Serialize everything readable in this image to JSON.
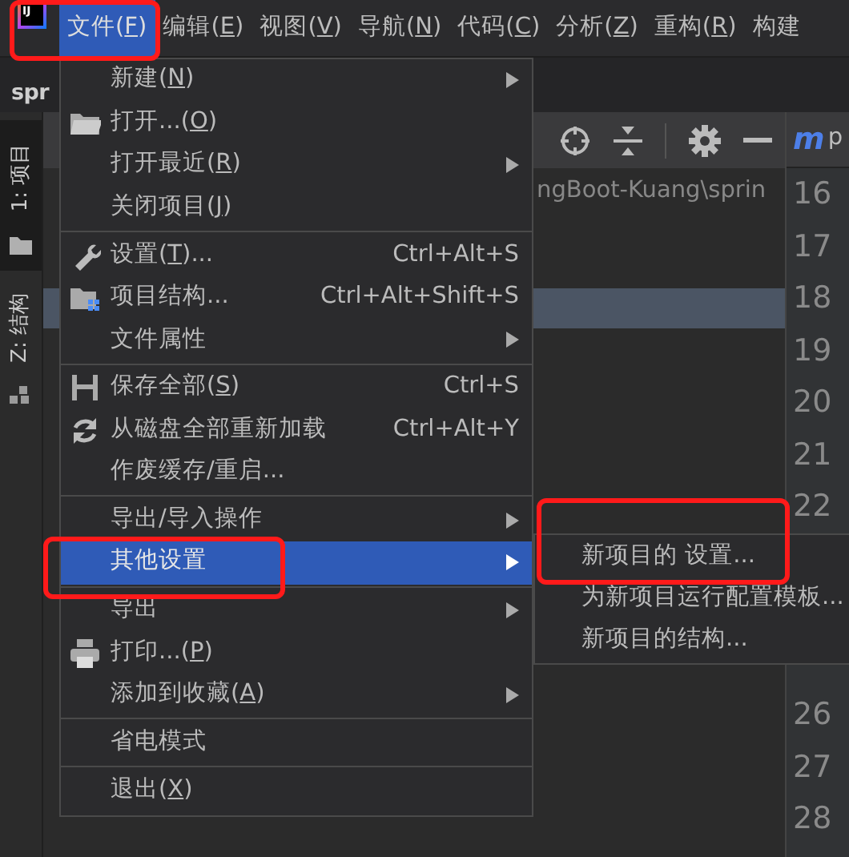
{
  "logo": {
    "text": "IJ"
  },
  "menu_bar": [
    {
      "label_parts": [
        "文件(",
        "F",
        ")"
      ],
      "selected": true,
      "annotated": true
    },
    {
      "label_parts": [
        "编辑(",
        "E",
        ")"
      ],
      "selected": false,
      "annotated": false
    },
    {
      "label_parts": [
        "视图(",
        "V",
        ")"
      ],
      "selected": false,
      "annotated": false
    },
    {
      "label_parts": [
        "导航(",
        "N",
        ")"
      ],
      "selected": false,
      "annotated": false
    },
    {
      "label_parts": [
        "代码(",
        "C",
        ")"
      ],
      "selected": false,
      "annotated": false
    },
    {
      "label_parts": [
        "分析(",
        "Z",
        ")"
      ],
      "selected": false,
      "annotated": false
    },
    {
      "label_parts": [
        "重构(",
        "R",
        ")"
      ],
      "selected": false,
      "annotated": false
    },
    {
      "label": "构建",
      "selected": false,
      "annotated": false
    }
  ],
  "navigation_bar": {
    "project": "spr"
  },
  "tool_strip": [
    {
      "label": "1: 项目",
      "selected": true
    },
    {
      "label": "Z: 结构",
      "selected": false
    }
  ],
  "project_panel": {
    "path": "ngBoot-Kuang\\sprin"
  },
  "editor": {
    "tab": {
      "icon_letter": "m",
      "label": "p"
    },
    "line_numbers": [
      "16",
      "17",
      "18",
      "19",
      "20",
      "21",
      "22"
    ],
    "line_numbers_below_menu": [
      "26",
      "27",
      "28"
    ]
  },
  "file_menu": {
    "items": [
      {
        "kind": "item",
        "label_parts": [
          "新建(",
          "N",
          ")"
        ],
        "has_submenu": true,
        "selected": false,
        "annotated": false
      },
      {
        "kind": "item",
        "label_parts": [
          "打开...(",
          "O",
          ")"
        ],
        "has_submenu": false,
        "selected": false,
        "annotated": false
      },
      {
        "kind": "item",
        "label_parts": [
          "打开最近(",
          "R",
          ")"
        ],
        "has_submenu": true,
        "selected": false,
        "annotated": false
      },
      {
        "kind": "item",
        "label_parts": [
          "关闭项目(",
          "J",
          ")"
        ],
        "has_submenu": false,
        "selected": false,
        "annotated": false
      },
      {
        "kind": "separator"
      },
      {
        "kind": "item",
        "label_parts": [
          "设置(",
          "T",
          ")..."
        ],
        "shortcut": "Ctrl+Alt+S",
        "has_submenu": false,
        "selected": false,
        "annotated": false
      },
      {
        "kind": "item",
        "label": "项目结构...",
        "shortcut": "Ctrl+Alt+Shift+S",
        "has_submenu": false,
        "selected": false,
        "annotated": false
      },
      {
        "kind": "item",
        "label": "文件属性",
        "has_submenu": true,
        "selected": false,
        "annotated": false
      },
      {
        "kind": "separator"
      },
      {
        "kind": "item",
        "label_parts": [
          "保存全部(",
          "S",
          ")"
        ],
        "shortcut": "Ctrl+S",
        "has_submenu": false,
        "selected": false,
        "annotated": false
      },
      {
        "kind": "item",
        "label": "从磁盘全部重新加载",
        "shortcut": "Ctrl+Alt+Y",
        "has_submenu": false,
        "selected": false,
        "annotated": false
      },
      {
        "kind": "item",
        "label": "作废缓存/重启...",
        "has_submenu": false,
        "selected": false,
        "annotated": false
      },
      {
        "kind": "separator"
      },
      {
        "kind": "item",
        "label": "导出/导入操作",
        "has_submenu": true,
        "selected": false,
        "annotated": false
      },
      {
        "kind": "item",
        "label": "其他设置",
        "has_submenu": true,
        "selected": true,
        "annotated": true
      },
      {
        "kind": "separator"
      },
      {
        "kind": "item",
        "label": "导出",
        "has_submenu": true,
        "selected": false,
        "annotated": false
      },
      {
        "kind": "item",
        "label_parts": [
          "打印...(",
          "P",
          ")"
        ],
        "has_submenu": false,
        "selected": false,
        "annotated": false
      },
      {
        "kind": "item",
        "label_parts": [
          "添加到收藏(",
          "A",
          ")"
        ],
        "has_submenu": true,
        "selected": false,
        "annotated": false
      },
      {
        "kind": "separator"
      },
      {
        "kind": "item",
        "label": "省电模式",
        "has_submenu": false,
        "selected": false,
        "annotated": false
      },
      {
        "kind": "separator"
      },
      {
        "kind": "item",
        "label_parts": [
          "退出(",
          "X",
          ")"
        ],
        "has_submenu": false,
        "selected": false,
        "annotated": false
      }
    ]
  },
  "other_settings_submenu": {
    "items": [
      {
        "label": "新项目的 设置...",
        "selected": false,
        "annotated": true
      },
      {
        "label": "为新项目运行配置模板...",
        "selected": false,
        "annotated": false
      },
      {
        "label": "新项目的结构...",
        "selected": false,
        "annotated": false
      }
    ]
  }
}
